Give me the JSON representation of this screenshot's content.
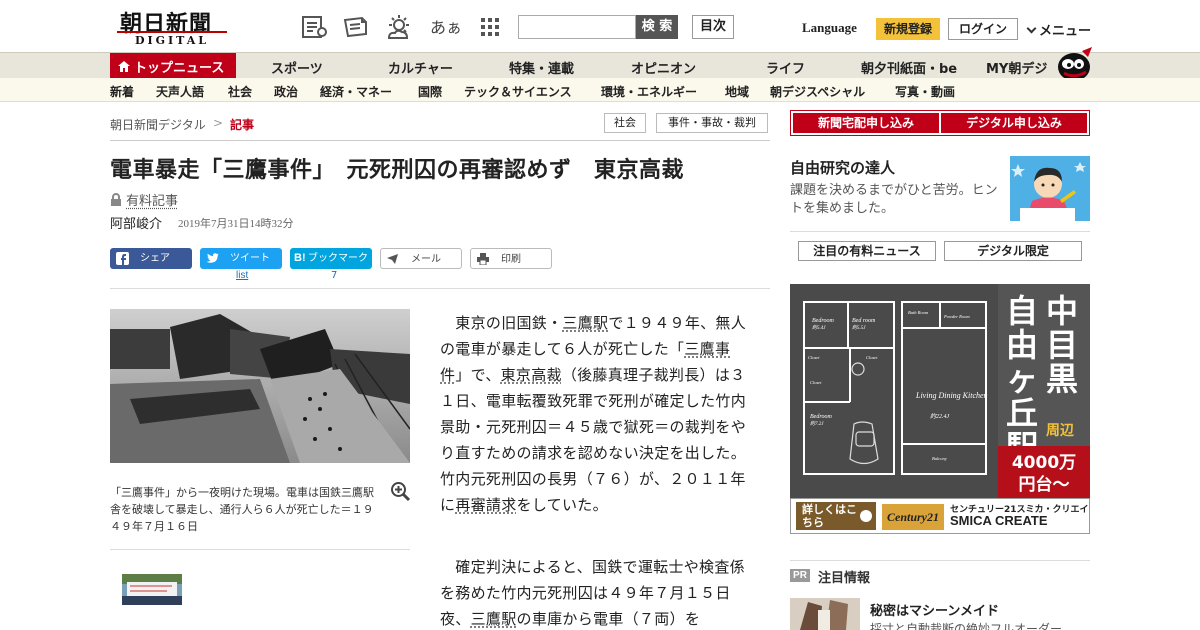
{
  "header": {
    "logo_jp": "朝日新聞",
    "logo_en": "DIGITAL",
    "search_button": "検 索",
    "mokuji_button": "目次",
    "language": "Language",
    "register": "新規登録",
    "login": "ログイン",
    "menu": "メニュー",
    "aa_label": "あぁ",
    "icons": [
      "article-list-icon",
      "newspaper-icon",
      "weather-icon",
      "font-size-icon",
      "grid-icon"
    ]
  },
  "nav_main": {
    "items": [
      "トップニュース",
      "スポーツ",
      "カルチャー",
      "特集・連載",
      "オピニオン",
      "ライフ",
      "朝夕刊紙面・be",
      "MY朝デジ"
    ],
    "active_index": 0
  },
  "nav_sub": {
    "items": [
      "新着",
      "天声人語",
      "社会",
      "政治",
      "経済・マネー",
      "国際",
      "テック＆サイエンス",
      "環境・エネルギー",
      "地域",
      "朝デジスペシャル",
      "写真・動画"
    ]
  },
  "breadcrumb": {
    "home": "朝日新聞デジタル",
    "sep": ">",
    "current": "記事"
  },
  "tags": [
    "社会",
    "事件・事故・裁判"
  ],
  "article": {
    "title": "電車暴走「三鷹事件」　元死刑囚の再審認めず　東京高裁",
    "paid_label": "有料記事",
    "author": "阿部峻介",
    "datetime": "2019年7月31日14時32分",
    "share": {
      "share": "シェア",
      "tweet": "ツイート",
      "tweet_sub": "list",
      "bookmark": "ブックマーク",
      "bookmark_count": "7",
      "mail": "メール",
      "print": "印刷"
    },
    "photo_caption": "「三鷹事件」から一夜明けた現場。電車は国鉄三鷹駅舎を破壊して暴走し、通行人ら６人が死亡した＝１９４９年７月１６日",
    "p1": [
      {
        "t": "　東京の旧国鉄・"
      },
      {
        "t": "三鷹駅",
        "link": true
      },
      {
        "t": "で１９４９年、無人の電車が暴走して６人が死亡した「"
      },
      {
        "t": "三鷹事件",
        "link": true
      },
      {
        "t": "」で、"
      },
      {
        "t": "東京高裁",
        "link": true
      },
      {
        "t": "（後藤真理子裁判長）は３１日、電車転覆致死罪で死刑が確定した竹内景助・元死刑囚＝４５歳で獄死＝の裁判をやり直すための請求を認めない決定を出した。竹内元死刑囚の長男（７６）が、２０１１年に"
      },
      {
        "t": "再審請求",
        "link": true
      },
      {
        "t": "をしていた。"
      }
    ],
    "p2": [
      {
        "t": "　確定判決によると、国鉄で運転士や検査係を務めた竹内元死刑囚は４９年７月１５日夜、"
      },
      {
        "t": "三鷹駅",
        "link": true
      },
      {
        "t": "の車庫から電車（７両）を"
      }
    ]
  },
  "sidebar": {
    "subscribe_paper": "新聞宅配申し込み",
    "subscribe_digital": "デジタル申し込み",
    "promo_title": "自由研究の達人",
    "promo_text": "課題を決めるまでがひと苦労。ヒントを集めました。",
    "tab_paid": "注目の有料ニュース",
    "tab_digital": "デジタル限定",
    "ad": {
      "headline_v1": "中目黒・",
      "headline_v2": "自由ヶ丘駅",
      "headline_sub": "周辺",
      "price": "4000万円台〜",
      "cta": "詳しくはこちら",
      "brand": "Century21",
      "company_jp": "センチュリー21スミカ・クリエイト",
      "company_en": "SMICA CREATE",
      "rooms": [
        "Bedroom",
        "Bed room",
        "Bath Room",
        "Powder Room",
        "Closet",
        "Closet",
        "Closet",
        "Bedroom",
        "Living Dining Kitchen",
        "Balcony"
      ],
      "room_sizes": [
        "約5.4J",
        "約5.5J",
        "約7.2J",
        "約22.4J"
      ]
    },
    "pr_badge": "PR",
    "featured_title": "注目情報",
    "featured_item_title": "秘密はマシーンメイド",
    "featured_item_text": "採寸と自動裁断の絶妙フルオーダー"
  },
  "colors": {
    "brand_red": "#c00018",
    "nav_bg": "#e8e5da",
    "subnav_bg": "#fbf8ec",
    "facebook": "#3b5998",
    "twitter": "#1da1f2",
    "hatena": "#00a4de",
    "register_yellow": "#f3c13a"
  }
}
